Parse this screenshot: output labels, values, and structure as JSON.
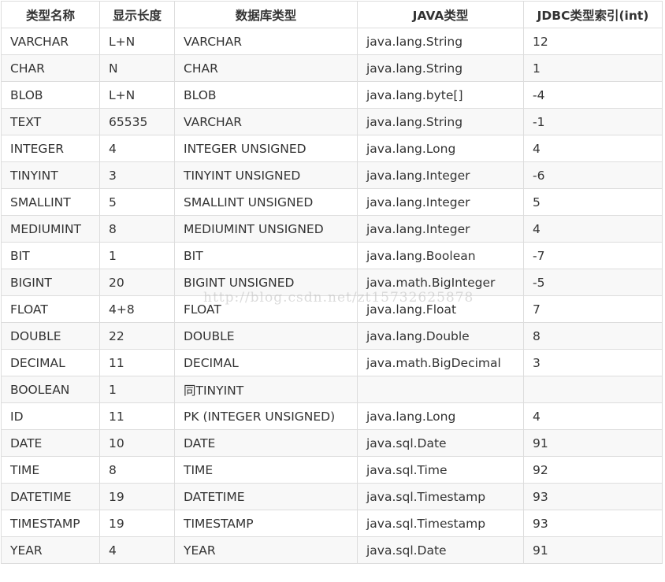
{
  "table": {
    "headers": [
      "类型名称",
      "显示长度",
      "数据库类型",
      "JAVA类型",
      "JDBC类型索引(int)"
    ],
    "rows": [
      [
        "VARCHAR",
        "L+N",
        "VARCHAR",
        "java.lang.String",
        "12"
      ],
      [
        "CHAR",
        "N",
        "CHAR",
        "java.lang.String",
        "1"
      ],
      [
        "BLOB",
        "L+N",
        "BLOB",
        "java.lang.byte[]",
        "-4"
      ],
      [
        "TEXT",
        "65535",
        "VARCHAR",
        "java.lang.String",
        "-1"
      ],
      [
        "INTEGER",
        "4",
        "INTEGER UNSIGNED",
        "java.lang.Long",
        "4"
      ],
      [
        "TINYINT",
        "3",
        "TINYINT UNSIGNED",
        "java.lang.Integer",
        "-6"
      ],
      [
        "SMALLINT",
        "5",
        "SMALLINT UNSIGNED",
        "java.lang.Integer",
        "5"
      ],
      [
        "MEDIUMINT",
        "8",
        "MEDIUMINT UNSIGNED",
        "java.lang.Integer",
        "4"
      ],
      [
        "BIT",
        "1",
        "BIT",
        "java.lang.Boolean",
        "-7"
      ],
      [
        "BIGINT",
        "20",
        "BIGINT UNSIGNED",
        "java.math.BigInteger",
        "-5"
      ],
      [
        "FLOAT",
        "4+8",
        "FLOAT",
        "java.lang.Float",
        "7"
      ],
      [
        "DOUBLE",
        "22",
        "DOUBLE",
        "java.lang.Double",
        "8"
      ],
      [
        "DECIMAL",
        "11",
        "DECIMAL",
        "java.math.BigDecimal",
        "3"
      ],
      [
        "BOOLEAN",
        "1",
        "同TINYINT",
        "",
        ""
      ],
      [
        "ID",
        "11",
        "PK (INTEGER UNSIGNED)",
        "java.lang.Long",
        "4"
      ],
      [
        "DATE",
        "10",
        "DATE",
        "java.sql.Date",
        "91"
      ],
      [
        "TIME",
        "8",
        "TIME",
        "java.sql.Time",
        "92"
      ],
      [
        "DATETIME",
        "19",
        "DATETIME",
        "java.sql.Timestamp",
        "93"
      ],
      [
        "TIMESTAMP",
        "19",
        "TIMESTAMP",
        "java.sql.Timestamp",
        "93"
      ],
      [
        "YEAR",
        "4",
        "YEAR",
        "java.sql.Date",
        "91"
      ]
    ]
  },
  "watermark": "http://blog.csdn.net/zt15732625878",
  "colors": {
    "border": "#dddddd",
    "row_alt": "#f8f8f8",
    "text": "#333333"
  }
}
